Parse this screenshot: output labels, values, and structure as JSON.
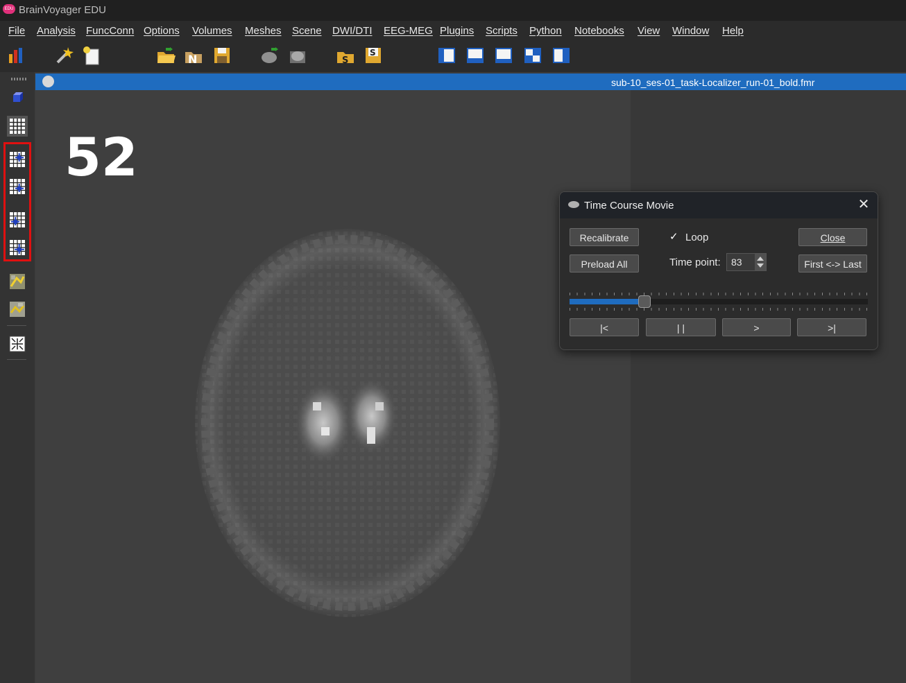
{
  "app": {
    "title": "BrainVoyager EDU",
    "logo_text": "EDU"
  },
  "menu": [
    "File",
    "Analysis",
    "FuncConn",
    "Options",
    "Volumes",
    "Meshes",
    "Scene",
    "DWI/DTI",
    "EEG-MEG",
    "Plugins",
    "Scripts",
    "Python",
    "Notebooks",
    "View",
    "Window",
    "Help"
  ],
  "document": {
    "filename": "sub-10_ses-01_task-Localizer_run-01_bold.fmr",
    "slice_number": "52"
  },
  "dialog": {
    "title": "Time Course Movie",
    "recalibrate": "Recalibrate",
    "preload_all": "Preload All",
    "loop_label": "Loop",
    "loop_checked": true,
    "time_point_label": "Time point:",
    "time_point_value": "83",
    "close_button": "Close",
    "first_last": "First <-> Last",
    "slider_fraction": 0.25,
    "first_btn": "|<",
    "pause_btn": "| |",
    "play_btn": ">",
    "last_btn": ">|"
  },
  "colors": {
    "accent": "#1f6cbf",
    "highlight": "#e01010"
  }
}
